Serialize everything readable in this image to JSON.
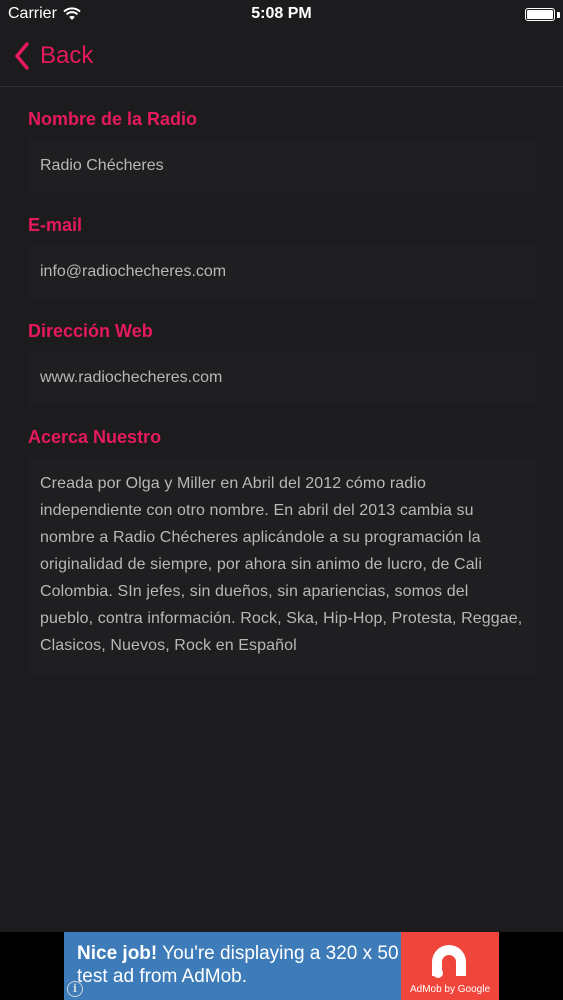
{
  "status_bar": {
    "carrier": "Carrier",
    "time": "5:08 PM",
    "battery_level": 1.0
  },
  "nav": {
    "back_label": "Back"
  },
  "fields": [
    {
      "label": "Nombre de la Radio",
      "value": "Radio Chécheres"
    },
    {
      "label": "E-mail",
      "value": "info@radiochecheres.com"
    },
    {
      "label": "Dirección Web",
      "value": "www.radiochecheres.com"
    }
  ],
  "about": {
    "label": "Acerca Nuestro",
    "text": "Creada por Olga y Miller en Abril del 2012 cómo radio independiente con otro nombre. En abril del 2013 cambia su nombre a Radio Chécheres aplicándole a su programación la originalidad de siempre, por ahora sin animo de lucro, de Cali Colombia. SIn jefes, sin dueños, sin apariencias, somos del pueblo, contra información. Rock, Ska, Hip-Hop, Protesta, Reggae, Clasicos, Nuevos, Rock en Español"
  },
  "ad": {
    "headline": "Nice job!",
    "body": " You're displaying a 320 x 50 test ad from AdMob.",
    "attribution": "AdMob by Google"
  },
  "colors": {
    "accent": "#e5195e",
    "background": "#1c1b1d",
    "ad_blue": "#3d7cb9",
    "ad_red": "#f0453a"
  }
}
